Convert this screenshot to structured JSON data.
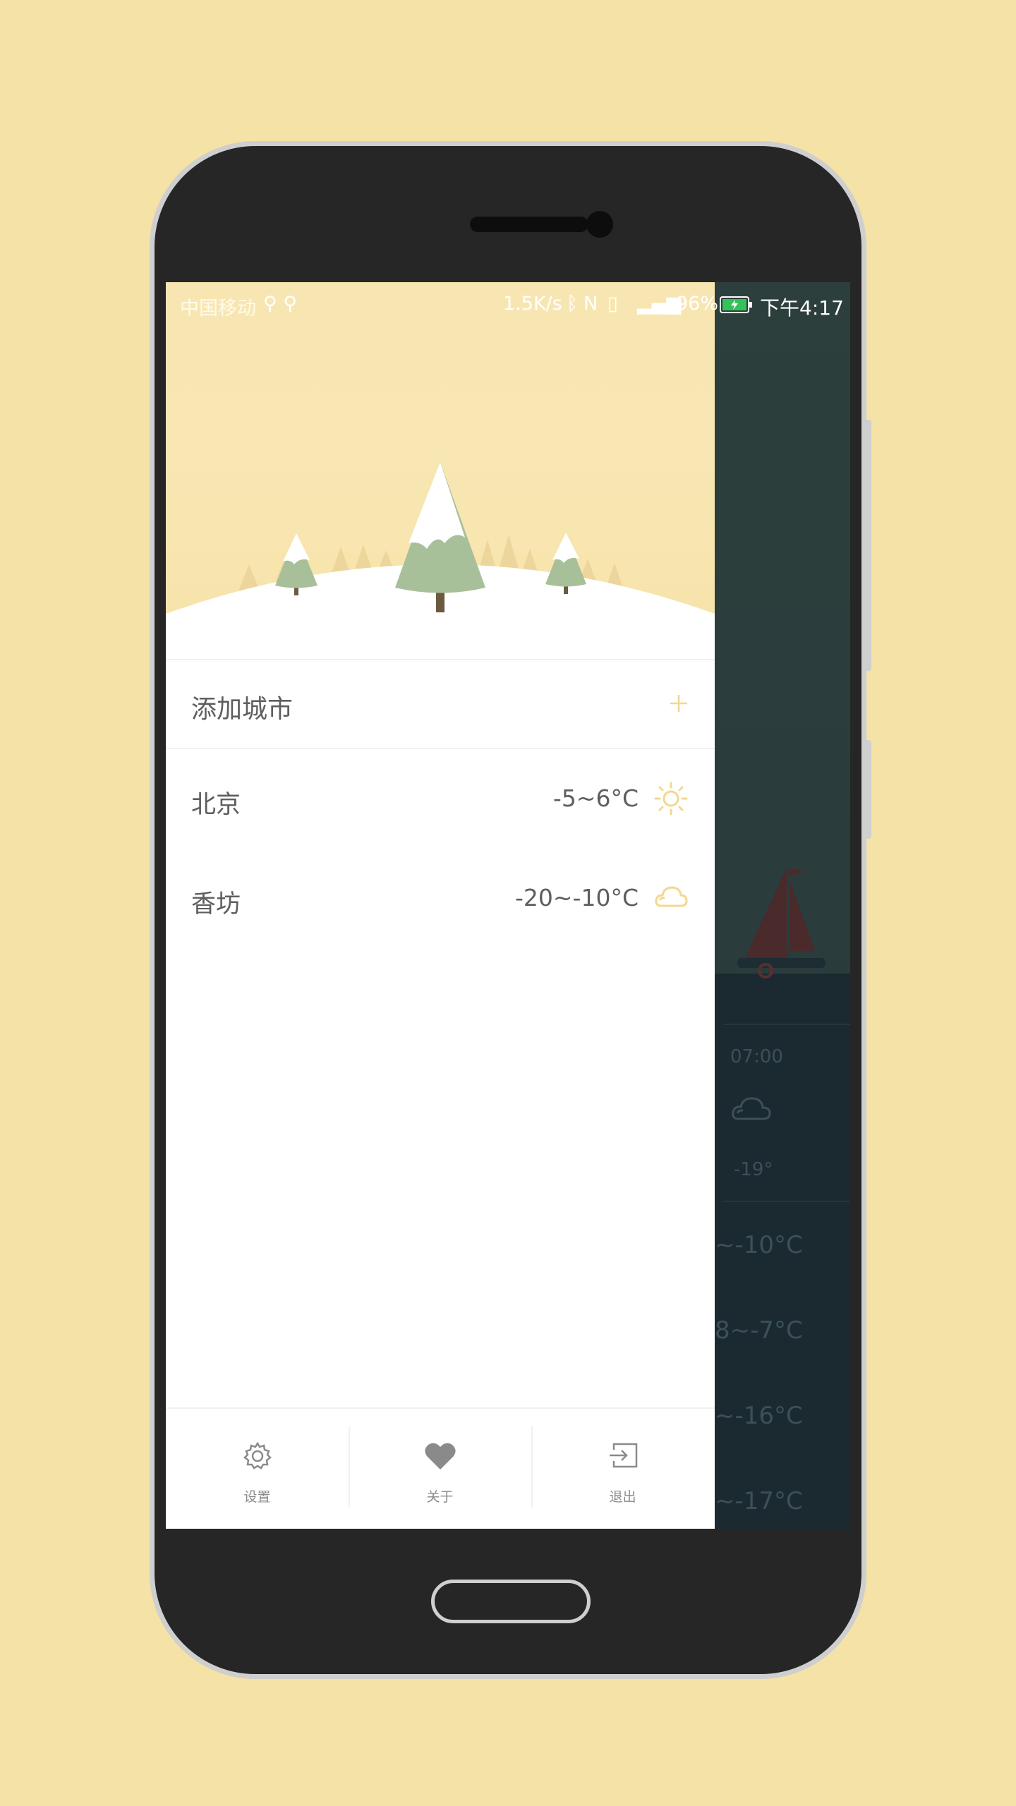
{
  "status_bar": {
    "carrier": "中国移动",
    "net_speed": "1.5K/s",
    "battery": "96%",
    "time": "下午4:17"
  },
  "drawer": {
    "add_city": {
      "label": "添加城市",
      "icon": "plus-icon"
    },
    "cities": [
      {
        "name": "北京",
        "temp": "-5~6°C",
        "icon": "sun-icon"
      },
      {
        "name": "香坊",
        "temp": "-20~-10°C",
        "icon": "cloud-icon"
      }
    ],
    "bottom_nav": [
      {
        "label": "设置",
        "icon": "gear-icon"
      },
      {
        "label": "关于",
        "icon": "heart-icon"
      },
      {
        "label": "退出",
        "icon": "exit-icon"
      }
    ]
  },
  "background_app": {
    "hourly_time": "07:00",
    "hourly_temp": "-19°",
    "daily_ranges": [
      "~-10°C",
      "8~-7°C",
      "~-16°C",
      "~-17°C"
    ]
  },
  "colors": {
    "page_background": "#f5e2a6",
    "accent_yellow": "#f3d88d",
    "text_gray": "#5e5e5e",
    "drawer_background": "#ffffff"
  }
}
